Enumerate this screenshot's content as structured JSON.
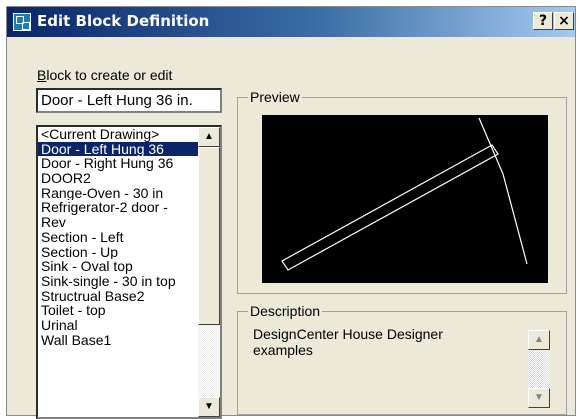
{
  "window": {
    "title": "Edit Block Definition",
    "help_label": "?",
    "close_label": "×"
  },
  "block_field": {
    "label_underlined": "B",
    "label_rest": "lock to create or edit",
    "value": "Door - Left Hung 36 in."
  },
  "block_list": {
    "items": [
      "<Current Drawing>",
      "Door - Left Hung 36",
      "Door - Right Hung 36",
      "DOOR2",
      "Range-Oven - 30 in",
      "Refrigerator-2 door -",
      "Rev",
      "Section - Left",
      "Section - Up",
      "Sink - Oval top",
      "Sink-single - 30 in top",
      "Structrual Base2",
      "Toilet - top",
      "Urinal",
      "Wall Base1"
    ],
    "selected_index": 1
  },
  "preview": {
    "label": "Preview",
    "background": "#000000",
    "stroke": "#ffffff"
  },
  "description": {
    "label": "Description",
    "text": "DesignCenter House Designer examples"
  }
}
